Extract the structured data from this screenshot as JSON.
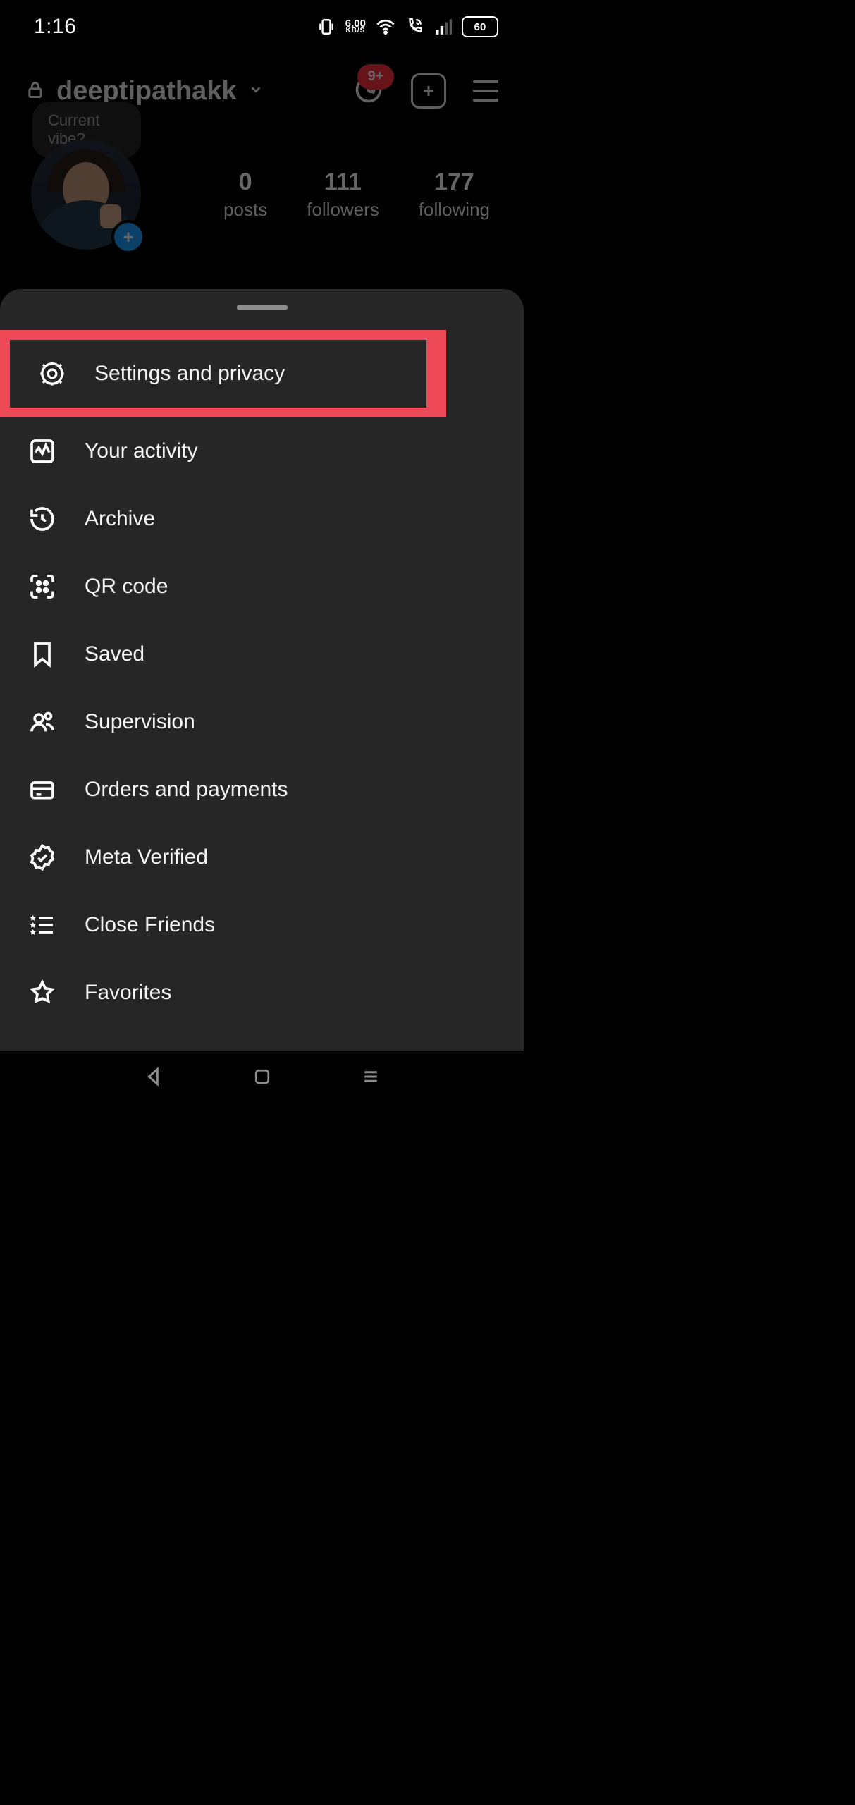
{
  "status": {
    "time": "1:16",
    "data_rate": "6.00",
    "data_unit": "KB/S",
    "battery": "60"
  },
  "header": {
    "username": "deeptipathakk",
    "threads_badge": "9+",
    "note": "Current vibe?"
  },
  "stats": {
    "posts_count": "0",
    "posts_label": "posts",
    "followers_count": "111",
    "followers_label": "followers",
    "following_count": "177",
    "following_label": "following"
  },
  "menu": {
    "settings": "Settings and privacy",
    "activity": "Your activity",
    "archive": "Archive",
    "qrcode": "QR code",
    "saved": "Saved",
    "supervision": "Supervision",
    "orders": "Orders and payments",
    "metaverified": "Meta Verified",
    "closefriends": "Close Friends",
    "favorites": "Favorites"
  }
}
